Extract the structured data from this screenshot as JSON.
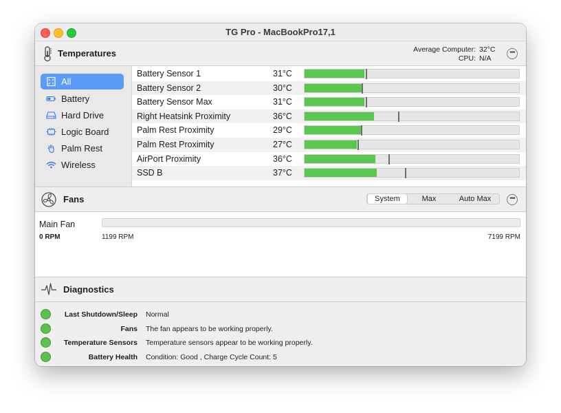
{
  "window": {
    "title": "TG Pro - MacBookPro17,1"
  },
  "temperatures": {
    "title": "Temperatures",
    "icon": "thermometer-icon",
    "average_label": "Average Computer:",
    "average_value": "32°C",
    "cpu_label": "CPU:",
    "cpu_value": "N/A",
    "categories": [
      {
        "label": "All",
        "icon": "chip-outline-icon",
        "selected": true
      },
      {
        "label": "Battery",
        "icon": "battery-icon",
        "selected": false
      },
      {
        "label": "Hard Drive",
        "icon": "hard-drive-icon",
        "selected": false
      },
      {
        "label": "Logic Board",
        "icon": "logic-board-icon",
        "selected": false
      },
      {
        "label": "Palm Rest",
        "icon": "hand-icon",
        "selected": false
      },
      {
        "label": "Wireless",
        "icon": "wifi-icon",
        "selected": false
      }
    ],
    "sensors": [
      {
        "name": "Battery Sensor 1",
        "value": "31°C",
        "fill": 0.28,
        "max": 0.29
      },
      {
        "name": "Battery Sensor 2",
        "value": "30°C",
        "fill": 0.27,
        "max": 0.27
      },
      {
        "name": "Battery Sensor Max",
        "value": "31°C",
        "fill": 0.28,
        "max": 0.29
      },
      {
        "name": "Right Heatsink Proximity",
        "value": "36°C",
        "fill": 0.325,
        "max": 0.44
      },
      {
        "name": "Palm Rest Proximity",
        "value": "29°C",
        "fill": 0.265,
        "max": 0.265
      },
      {
        "name": "Palm Rest Proximity",
        "value": "27°C",
        "fill": 0.245,
        "max": 0.25
      },
      {
        "name": "AirPort Proximity",
        "value": "36°C",
        "fill": 0.33,
        "max": 0.395
      },
      {
        "name": "SSD B",
        "value": "37°C",
        "fill": 0.335,
        "max": 0.47
      }
    ]
  },
  "fans": {
    "title": "Fans",
    "icon": "fan-icon",
    "modes": [
      {
        "label": "System",
        "active": true
      },
      {
        "label": "Max",
        "active": false
      },
      {
        "label": "Auto Max",
        "active": false
      }
    ],
    "items": [
      {
        "name": "Main Fan",
        "current": "0 RPM",
        "min": "1199 RPM",
        "max": "7199 RPM",
        "fill": 0
      }
    ]
  },
  "diagnostics": {
    "title": "Diagnostics",
    "icon": "pulse-icon",
    "items": [
      {
        "label": "Last Shutdown/Sleep",
        "value": "Normal",
        "status_color": "#5cc24d"
      },
      {
        "label": "Fans",
        "value": "The fan appears to be working properly.",
        "status_color": "#5cc24d"
      },
      {
        "label": "Temperature Sensors",
        "value": "Temperature sensors appear to be working properly.",
        "status_color": "#5cc24d"
      },
      {
        "label": "Battery Health",
        "value": "Condition: Good , Charge Cycle Count: 5",
        "status_color": "#5cc24d"
      }
    ]
  }
}
